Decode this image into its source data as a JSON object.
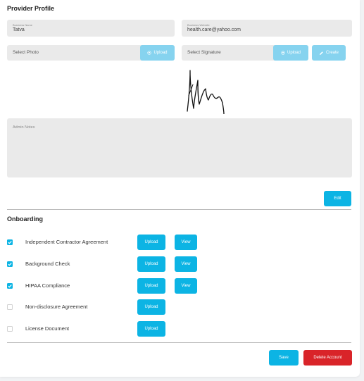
{
  "profile": {
    "title": "Provider Profile",
    "business_name": {
      "label": "Business Name",
      "value": "Tatva"
    },
    "business_website": {
      "label": "Business Website",
      "value": "health.care@yahoo.com"
    },
    "photo": {
      "placeholder": "Select Photo",
      "upload_label": "Upload"
    },
    "signature": {
      "placeholder": "Select Signature",
      "upload_label": "Upload",
      "create_label": "Create"
    },
    "admin_notes": {
      "label": "Admin Notes"
    },
    "edit_label": "Edit"
  },
  "onboarding": {
    "title": "Onboarding",
    "items": [
      {
        "label": "Independent Contractor Agreement",
        "checked": true,
        "upload_label": "Upload",
        "view_label": "View"
      },
      {
        "label": "Background Check",
        "checked": true,
        "upload_label": "Upload",
        "view_label": "View"
      },
      {
        "label": "HIPAA Compliance",
        "checked": true,
        "upload_label": "Upload",
        "view_label": "View"
      },
      {
        "label": "Non-disclosure Agreement",
        "checked": false,
        "upload_label": "Upload"
      },
      {
        "label": "License Document",
        "checked": false,
        "upload_label": "Upload"
      }
    ]
  },
  "footer": {
    "save_label": "Save",
    "delete_label": "Delete Account"
  },
  "colors": {
    "accent": "#0cb4e4",
    "accent_faded": "#86d3ef",
    "danger": "#d92429",
    "field_bg": "#eaeaea"
  }
}
